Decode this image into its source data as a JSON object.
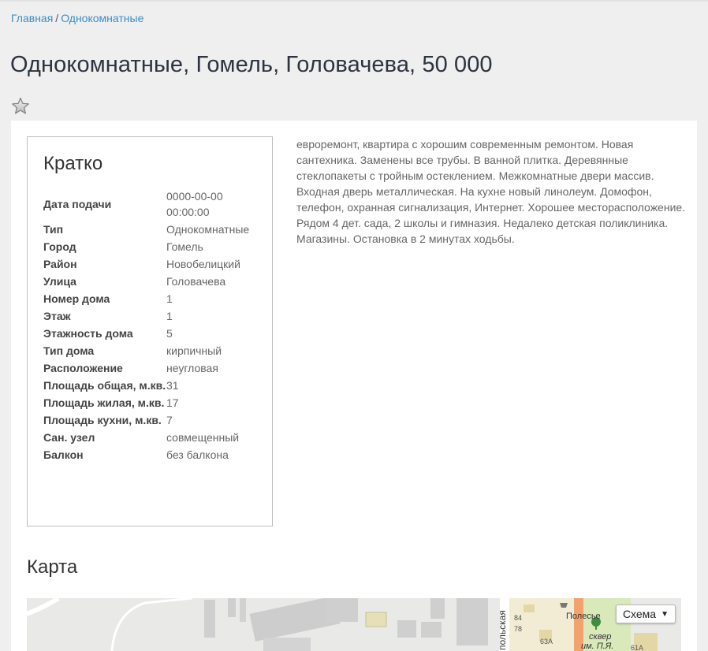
{
  "breadcrumb": {
    "home": "Главная",
    "separator": "/",
    "current": "Однокомнатные"
  },
  "page_title": "Однокомнатные, Гомель, Головачева, 50 000",
  "favorite_icon": "star-icon",
  "summary": {
    "heading": "Кратко",
    "rows": [
      {
        "key": "Дата подачи",
        "value": "0000-00-00 00:00:00"
      },
      {
        "key": "Тип",
        "value": "Однокомнатные"
      },
      {
        "key": "Город",
        "value": "Гомель"
      },
      {
        "key": "Район",
        "value": "Новобелицкий"
      },
      {
        "key": "Улица",
        "value": "Головачева"
      },
      {
        "key": "Номер дома",
        "value": "1"
      },
      {
        "key": "Этаж",
        "value": "1"
      },
      {
        "key": "Этажность дома",
        "value": "5"
      },
      {
        "key": "Тип дома",
        "value": "кирпичный"
      },
      {
        "key": "Расположение",
        "value": "неугловая"
      },
      {
        "key": "Площадь общая, м.кв.",
        "value": "31"
      },
      {
        "key": "Площадь жилая, м.кв.",
        "value": "17"
      },
      {
        "key": "Площадь кухни, м.кв.",
        "value": "7"
      },
      {
        "key": "Сан. узел",
        "value": "совмещенный"
      },
      {
        "key": "Балкон",
        "value": "без балкона"
      }
    ]
  },
  "description": "евроремонт, квартира с хорошим современным ремонтом. Новая сантехника. Заменены все трубы. В ванной плитка. Деревянные стеклопакеты с тройным остеклением. Межкомнатные двери массив. Входная дверь металлическая. На кухне новый линолеум. Домофон, телефон, охранная сигнализация, Интернет. Хорошее месторасположение. Рядом 4 дет. сада, 2 школы и гимназия. Недалеко детская поликлиника. Магазины. Остановка в 2 минутах ходьбы.",
  "map": {
    "heading": "Карта",
    "scheme_button": "Схема",
    "labels": {
      "street": "польская",
      "poi": "Полесье",
      "park_line1": "сквер",
      "park_line2": "им. П.Я.",
      "n1": "84",
      "n2": "78",
      "n3": "63А",
      "n4": "61А"
    }
  }
}
